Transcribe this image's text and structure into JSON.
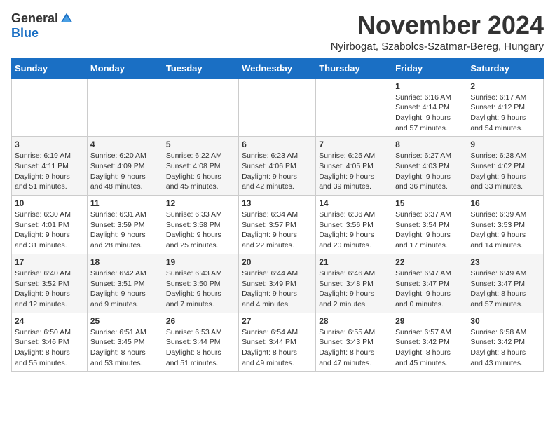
{
  "header": {
    "logo_general": "General",
    "logo_blue": "Blue",
    "month_title": "November 2024",
    "location": "Nyirbogat, Szabolcs-Szatmar-Bereg, Hungary"
  },
  "days_of_week": [
    "Sunday",
    "Monday",
    "Tuesday",
    "Wednesday",
    "Thursday",
    "Friday",
    "Saturday"
  ],
  "weeks": [
    [
      {
        "day": "",
        "info": ""
      },
      {
        "day": "",
        "info": ""
      },
      {
        "day": "",
        "info": ""
      },
      {
        "day": "",
        "info": ""
      },
      {
        "day": "",
        "info": ""
      },
      {
        "day": "1",
        "info": "Sunrise: 6:16 AM\nSunset: 4:14 PM\nDaylight: 9 hours\nand 57 minutes."
      },
      {
        "day": "2",
        "info": "Sunrise: 6:17 AM\nSunset: 4:12 PM\nDaylight: 9 hours\nand 54 minutes."
      }
    ],
    [
      {
        "day": "3",
        "info": "Sunrise: 6:19 AM\nSunset: 4:11 PM\nDaylight: 9 hours\nand 51 minutes."
      },
      {
        "day": "4",
        "info": "Sunrise: 6:20 AM\nSunset: 4:09 PM\nDaylight: 9 hours\nand 48 minutes."
      },
      {
        "day": "5",
        "info": "Sunrise: 6:22 AM\nSunset: 4:08 PM\nDaylight: 9 hours\nand 45 minutes."
      },
      {
        "day": "6",
        "info": "Sunrise: 6:23 AM\nSunset: 4:06 PM\nDaylight: 9 hours\nand 42 minutes."
      },
      {
        "day": "7",
        "info": "Sunrise: 6:25 AM\nSunset: 4:05 PM\nDaylight: 9 hours\nand 39 minutes."
      },
      {
        "day": "8",
        "info": "Sunrise: 6:27 AM\nSunset: 4:03 PM\nDaylight: 9 hours\nand 36 minutes."
      },
      {
        "day": "9",
        "info": "Sunrise: 6:28 AM\nSunset: 4:02 PM\nDaylight: 9 hours\nand 33 minutes."
      }
    ],
    [
      {
        "day": "10",
        "info": "Sunrise: 6:30 AM\nSunset: 4:01 PM\nDaylight: 9 hours\nand 31 minutes."
      },
      {
        "day": "11",
        "info": "Sunrise: 6:31 AM\nSunset: 3:59 PM\nDaylight: 9 hours\nand 28 minutes."
      },
      {
        "day": "12",
        "info": "Sunrise: 6:33 AM\nSunset: 3:58 PM\nDaylight: 9 hours\nand 25 minutes."
      },
      {
        "day": "13",
        "info": "Sunrise: 6:34 AM\nSunset: 3:57 PM\nDaylight: 9 hours\nand 22 minutes."
      },
      {
        "day": "14",
        "info": "Sunrise: 6:36 AM\nSunset: 3:56 PM\nDaylight: 9 hours\nand 20 minutes."
      },
      {
        "day": "15",
        "info": "Sunrise: 6:37 AM\nSunset: 3:54 PM\nDaylight: 9 hours\nand 17 minutes."
      },
      {
        "day": "16",
        "info": "Sunrise: 6:39 AM\nSunset: 3:53 PM\nDaylight: 9 hours\nand 14 minutes."
      }
    ],
    [
      {
        "day": "17",
        "info": "Sunrise: 6:40 AM\nSunset: 3:52 PM\nDaylight: 9 hours\nand 12 minutes."
      },
      {
        "day": "18",
        "info": "Sunrise: 6:42 AM\nSunset: 3:51 PM\nDaylight: 9 hours\nand 9 minutes."
      },
      {
        "day": "19",
        "info": "Sunrise: 6:43 AM\nSunset: 3:50 PM\nDaylight: 9 hours\nand 7 minutes."
      },
      {
        "day": "20",
        "info": "Sunrise: 6:44 AM\nSunset: 3:49 PM\nDaylight: 9 hours\nand 4 minutes."
      },
      {
        "day": "21",
        "info": "Sunrise: 6:46 AM\nSunset: 3:48 PM\nDaylight: 9 hours\nand 2 minutes."
      },
      {
        "day": "22",
        "info": "Sunrise: 6:47 AM\nSunset: 3:47 PM\nDaylight: 9 hours\nand 0 minutes."
      },
      {
        "day": "23",
        "info": "Sunrise: 6:49 AM\nSunset: 3:47 PM\nDaylight: 8 hours\nand 57 minutes."
      }
    ],
    [
      {
        "day": "24",
        "info": "Sunrise: 6:50 AM\nSunset: 3:46 PM\nDaylight: 8 hours\nand 55 minutes."
      },
      {
        "day": "25",
        "info": "Sunrise: 6:51 AM\nSunset: 3:45 PM\nDaylight: 8 hours\nand 53 minutes."
      },
      {
        "day": "26",
        "info": "Sunrise: 6:53 AM\nSunset: 3:44 PM\nDaylight: 8 hours\nand 51 minutes."
      },
      {
        "day": "27",
        "info": "Sunrise: 6:54 AM\nSunset: 3:44 PM\nDaylight: 8 hours\nand 49 minutes."
      },
      {
        "day": "28",
        "info": "Sunrise: 6:55 AM\nSunset: 3:43 PM\nDaylight: 8 hours\nand 47 minutes."
      },
      {
        "day": "29",
        "info": "Sunrise: 6:57 AM\nSunset: 3:42 PM\nDaylight: 8 hours\nand 45 minutes."
      },
      {
        "day": "30",
        "info": "Sunrise: 6:58 AM\nSunset: 3:42 PM\nDaylight: 8 hours\nand 43 minutes."
      }
    ]
  ]
}
